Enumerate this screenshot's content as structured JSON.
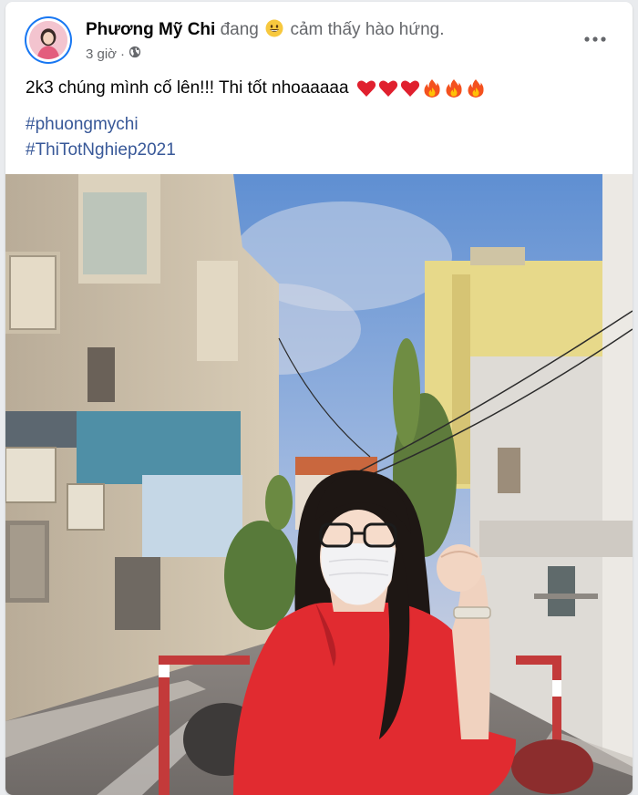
{
  "post": {
    "author": "Phương Mỹ Chi",
    "feeling_prefix": "đang",
    "feeling_emoji": "grinning-face-icon",
    "feeling_text": "cảm thấy hào hứng.",
    "time": "3 giờ",
    "separator": "·",
    "privacy_icon": "globe-icon",
    "body_text": "2k3 chúng mình cố lên!!! Thi tốt nhoaaaaa",
    "emojis": [
      "red-heart-icon",
      "red-heart-icon",
      "red-heart-icon",
      "fire-icon",
      "fire-icon",
      "fire-icon"
    ],
    "hashtags": [
      "#phuongmychi",
      "#ThiTotNghiep2021"
    ]
  },
  "colors": {
    "link": "#385898",
    "secondary_text": "#65676b",
    "avatar_ring": "#1877f2"
  }
}
